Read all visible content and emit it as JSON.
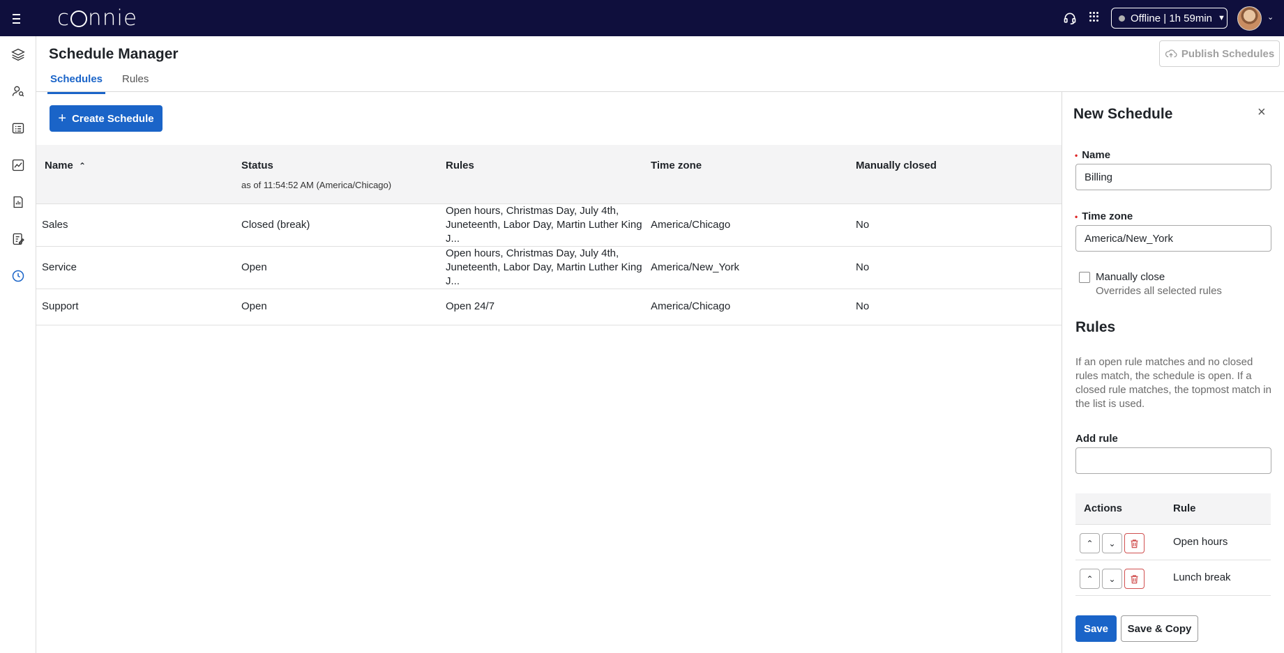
{
  "app": {
    "logo_text": "connie"
  },
  "topbar": {
    "status_label": "Offline | 1h 59min",
    "status_color": "#b0b0b0"
  },
  "header": {
    "title": "Schedule Manager",
    "publish_label": "Publish Schedules"
  },
  "tabs": [
    {
      "label": "Schedules",
      "active": true
    },
    {
      "label": "Rules",
      "active": false
    }
  ],
  "main": {
    "create_label": "Create Schedule",
    "columns": {
      "name": "Name",
      "status": "Status",
      "status_sub": "as of 11:54:52 AM (America/Chicago)",
      "rules": "Rules",
      "timezone": "Time zone",
      "manually_closed": "Manually closed"
    },
    "rows": [
      {
        "name": "Sales",
        "status": "Closed (break)",
        "rules": "Open hours, Christmas Day, July 4th, Juneteenth, Labor Day, Martin Luther King J...",
        "timezone": "America/Chicago",
        "manually_closed": "No"
      },
      {
        "name": "Service",
        "status": "Open",
        "rules": "Open hours, Christmas Day, July 4th, Juneteenth, Labor Day, Martin Luther King J...",
        "timezone": "America/New_York",
        "manually_closed": "No"
      },
      {
        "name": "Support",
        "status": "Open",
        "rules": "Open 24/7",
        "timezone": "America/Chicago",
        "manually_closed": "No"
      }
    ]
  },
  "panel": {
    "title": "New Schedule",
    "name_label": "Name",
    "name_value": "Billing",
    "tz_label": "Time zone",
    "tz_value": "America/New_York",
    "manual_label": "Manually close",
    "manual_hint": "Overrides all selected rules",
    "rules_title": "Rules",
    "rules_desc": "If an open rule matches and no closed rules match, the schedule is open. If a closed rule matches, the topmost match in the list is used.",
    "add_rule_label": "Add rule",
    "add_rule_value": "",
    "rt_actions": "Actions",
    "rt_rule": "Rule",
    "rule_rows": [
      {
        "rule": "Open hours"
      },
      {
        "rule": "Lunch break"
      }
    ],
    "save_label": "Save",
    "save_copy_label": "Save & Copy"
  },
  "colors": {
    "topbar_bg": "#0f0f3d",
    "accent": "#1a64c8",
    "danger": "#d05050"
  }
}
